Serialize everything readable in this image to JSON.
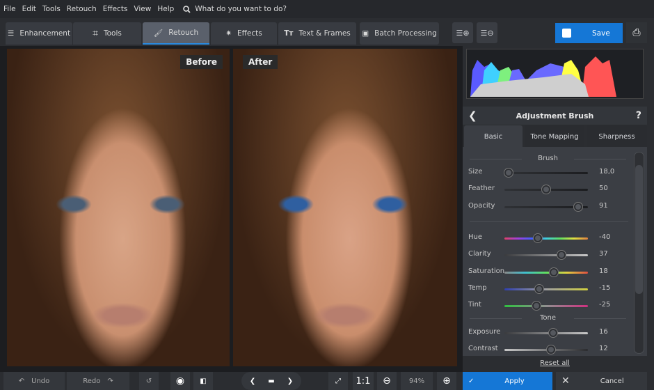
{
  "menu": [
    "File",
    "Edit",
    "Tools",
    "Retouch",
    "Effects",
    "View",
    "Help"
  ],
  "search": {
    "placeholder": "What do you want to do?",
    "icon": "search-icon"
  },
  "tabs": [
    {
      "label": "Enhancement",
      "icon": "sliders-icon"
    },
    {
      "label": "Tools",
      "icon": "crop-icon"
    },
    {
      "label": "Retouch",
      "icon": "brush-icon",
      "active": true
    },
    {
      "label": "Effects",
      "icon": "magic-wand-icon"
    },
    {
      "label": "Text & Frames",
      "icon": "text-icon"
    },
    {
      "label": "Batch Processing",
      "icon": "images-icon"
    }
  ],
  "toolbar": {
    "save_label": "Save"
  },
  "preview": {
    "before_label": "Before",
    "after_label": "After"
  },
  "panel": {
    "title": "Adjustment Brush",
    "help": "?",
    "tabs": [
      "Basic",
      "Tone Mapping",
      "Sharpness"
    ],
    "active_tab": "Basic",
    "brush_section": "Brush",
    "tone_section": "Tone",
    "sliders": [
      {
        "label": "Size",
        "value": "18,0",
        "level": 0.05,
        "track": "dark"
      },
      {
        "label": "Feather",
        "value": "50",
        "level": 0.5,
        "track": "dark"
      },
      {
        "label": "Opacity",
        "value": "91",
        "level": 0.88,
        "track": "dark"
      },
      {
        "label": "Hue",
        "value": "-40",
        "level": 0.4,
        "track": "hue"
      },
      {
        "label": "Clarity",
        "value": "37",
        "level": 0.68,
        "track": "clarity"
      },
      {
        "label": "Saturation",
        "value": "18",
        "level": 0.59,
        "track": "saturation"
      },
      {
        "label": "Temp",
        "value": "-15",
        "level": 0.42,
        "track": "temp"
      },
      {
        "label": "Tint",
        "value": "-25",
        "level": 0.38,
        "track": "tint"
      },
      {
        "label": "Exposure",
        "value": "16",
        "level": 0.58,
        "track": "clarity"
      },
      {
        "label": "Contrast",
        "value": "12",
        "level": 0.56,
        "track": "contrast"
      }
    ],
    "reset_label": "Reset all"
  },
  "bottom": {
    "undo": "Undo",
    "redo": "Redo",
    "ratio": "1:1",
    "zoom": "94%",
    "apply": "Apply",
    "cancel": "Cancel"
  },
  "colors": {
    "accent": "#1577d6",
    "background": "#2b2d31"
  }
}
